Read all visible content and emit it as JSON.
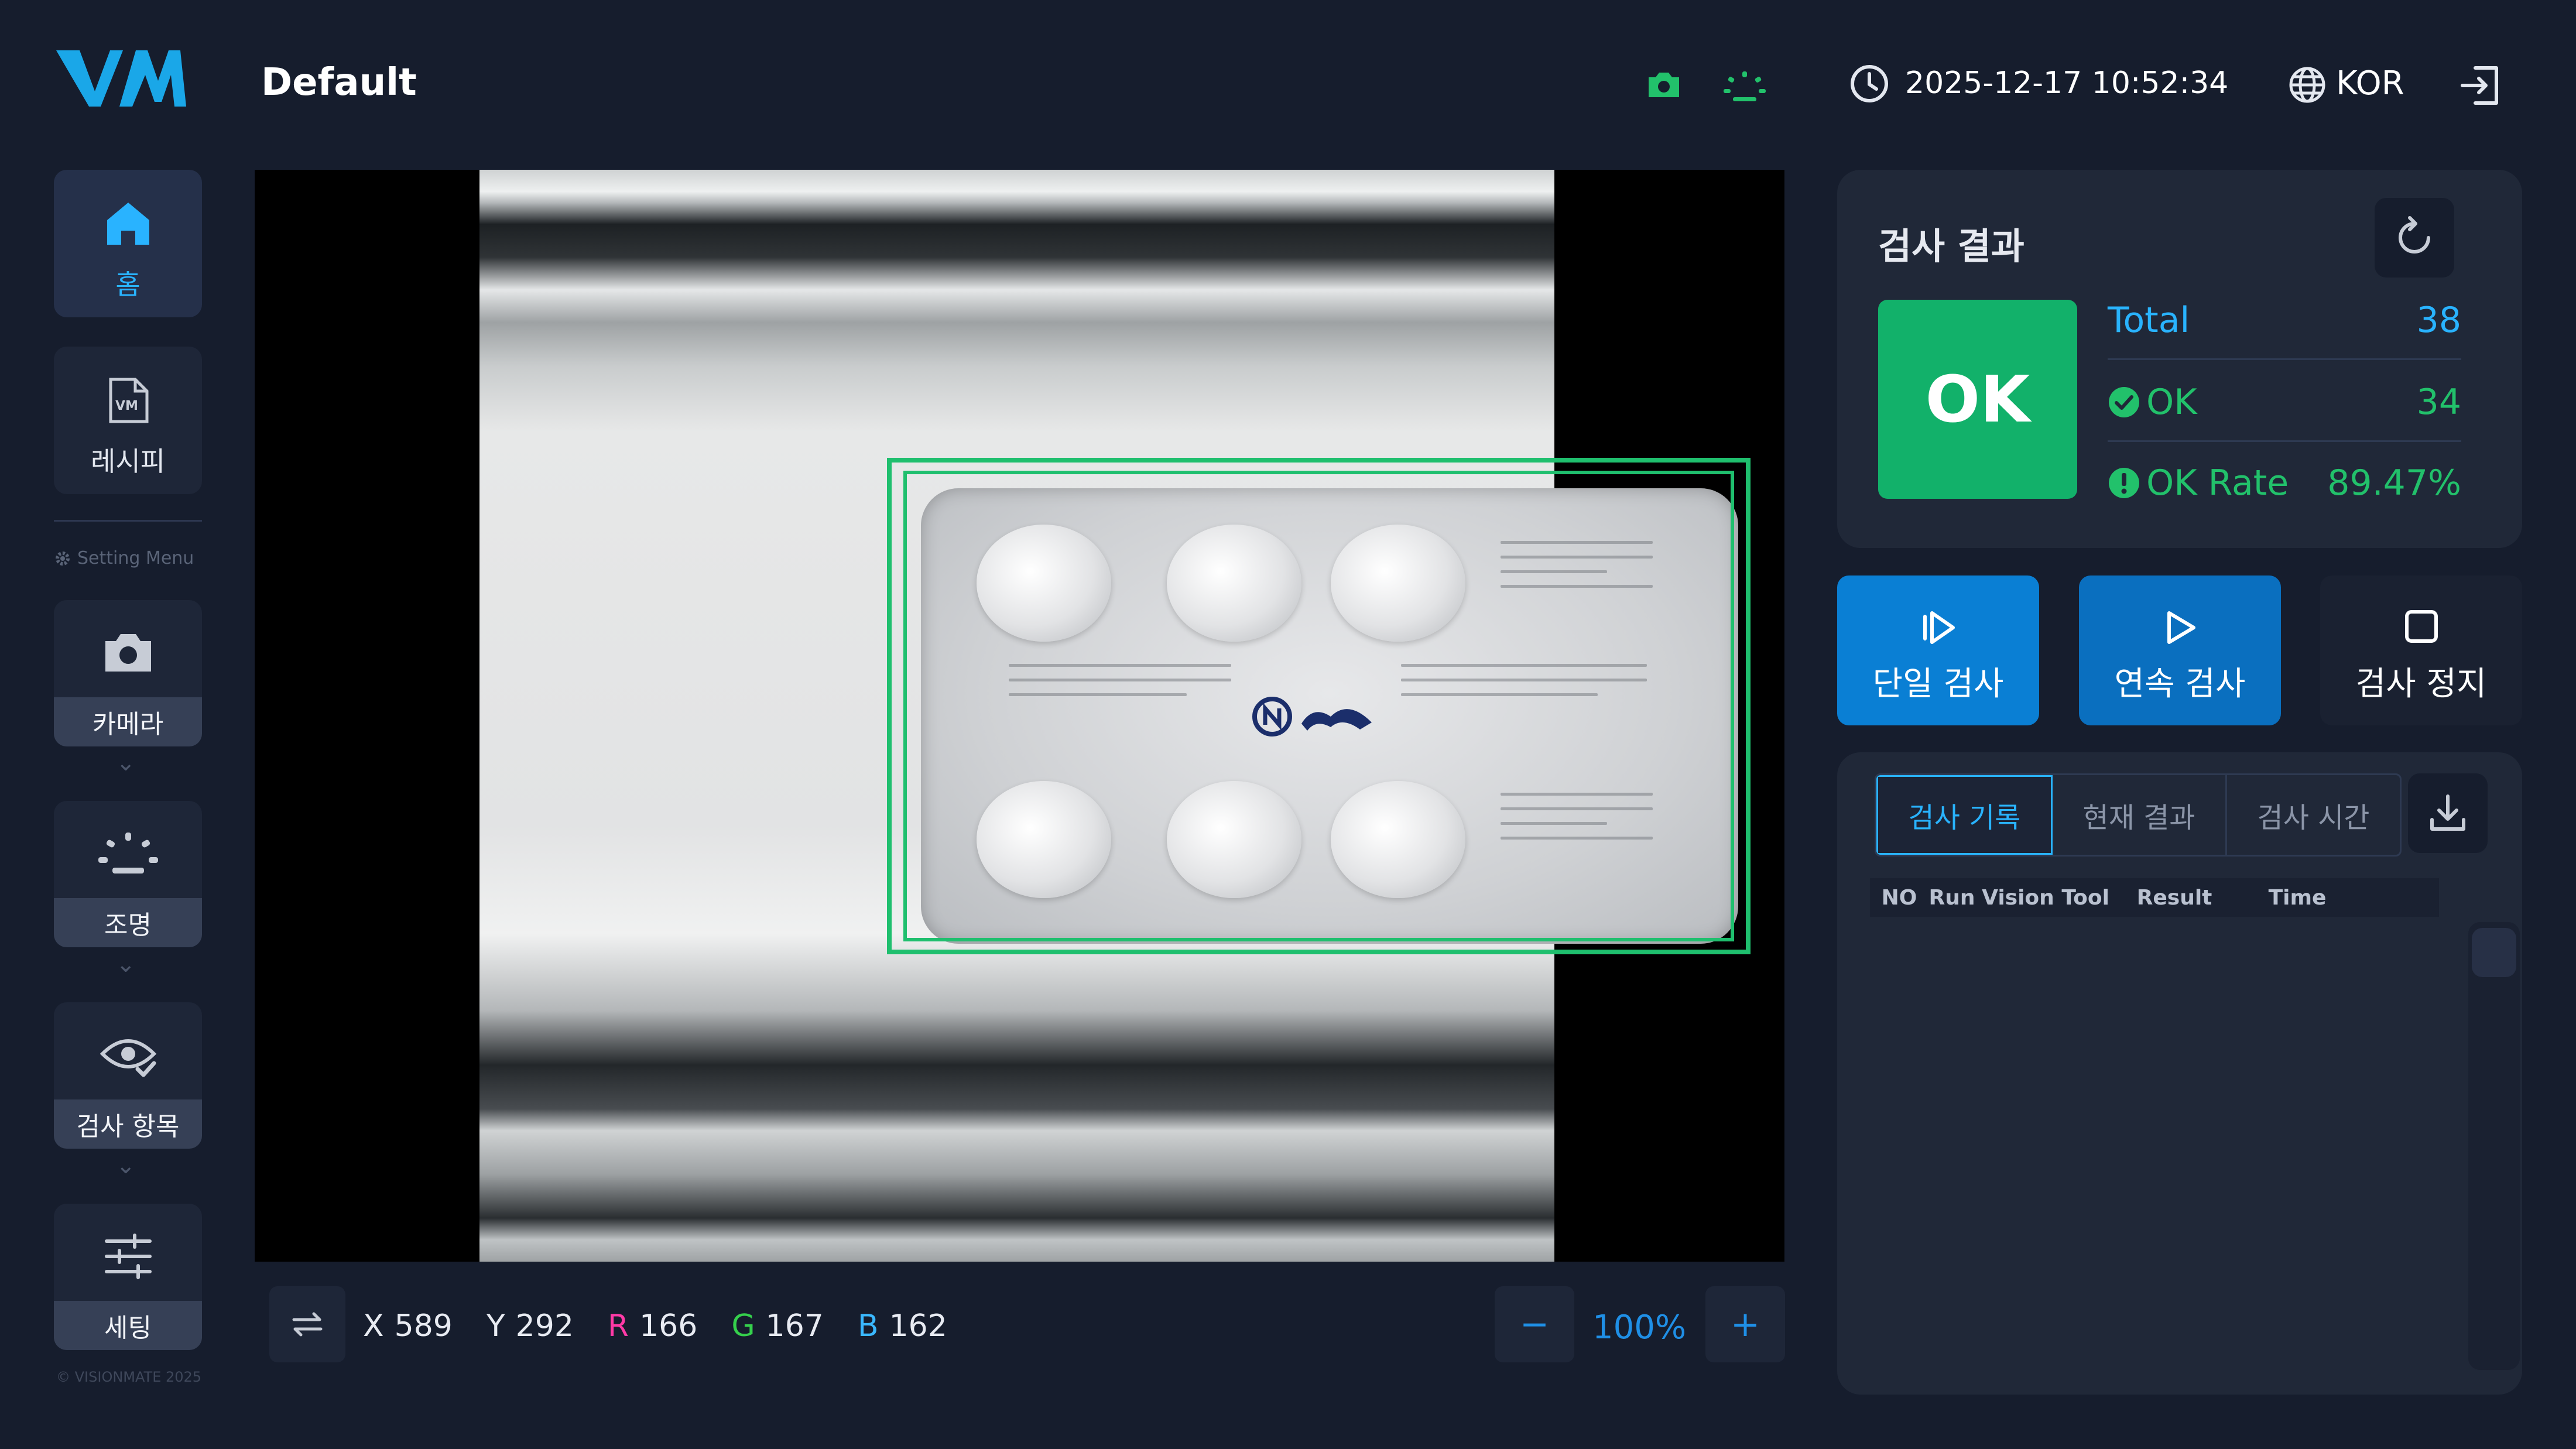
{
  "header": {
    "logo_text": "VM",
    "title": "Default",
    "datetime": "2025-12-17 10:52:34",
    "language": "KOR"
  },
  "sidebar": {
    "items": [
      {
        "label": "홈",
        "icon": "home-icon"
      },
      {
        "label": "레시피",
        "icon": "recipe-file-icon"
      }
    ],
    "setting_menu_label": "Setting Menu",
    "settings": [
      {
        "label": "카메라",
        "icon": "camera-icon"
      },
      {
        "label": "조명",
        "icon": "lighting-icon"
      },
      {
        "label": "검사 항목",
        "icon": "eye-check-icon"
      },
      {
        "label": "세팅",
        "icon": "sliders-icon"
      }
    ],
    "chevron": "⌄",
    "copyright": "© VISIONMATE 2025"
  },
  "viewer": {
    "x_label": "X",
    "x_value": "589",
    "y_label": "Y",
    "y_value": "292",
    "r_label": "R",
    "r_value": "166",
    "g_label": "G",
    "g_value": "167",
    "b_label": "B",
    "b_value": "162",
    "zoom": "100%",
    "zoom_minus": "−",
    "zoom_plus": "+"
  },
  "result": {
    "title": "검사 결과",
    "status": "OK",
    "total_label": "Total",
    "total_value": "38",
    "ok_label": "OK",
    "ok_value": "34",
    "rate_label": "OK Rate",
    "rate_value": "89.47%"
  },
  "actions": {
    "single": "단일 검사",
    "continuous": "연속 검사",
    "stop": "검사 정지"
  },
  "log": {
    "tabs": [
      "검사 기록",
      "현재 결과",
      "검사 시간"
    ],
    "columns": [
      "NO",
      "Run",
      "Vision Tool",
      "Result",
      "Time"
    ]
  },
  "colors": {
    "background": "#161d2d",
    "panel": "#202838",
    "accent_blue": "#29b3ff",
    "ok_green": "#12b16a",
    "roi_green": "#1fbf6e"
  }
}
